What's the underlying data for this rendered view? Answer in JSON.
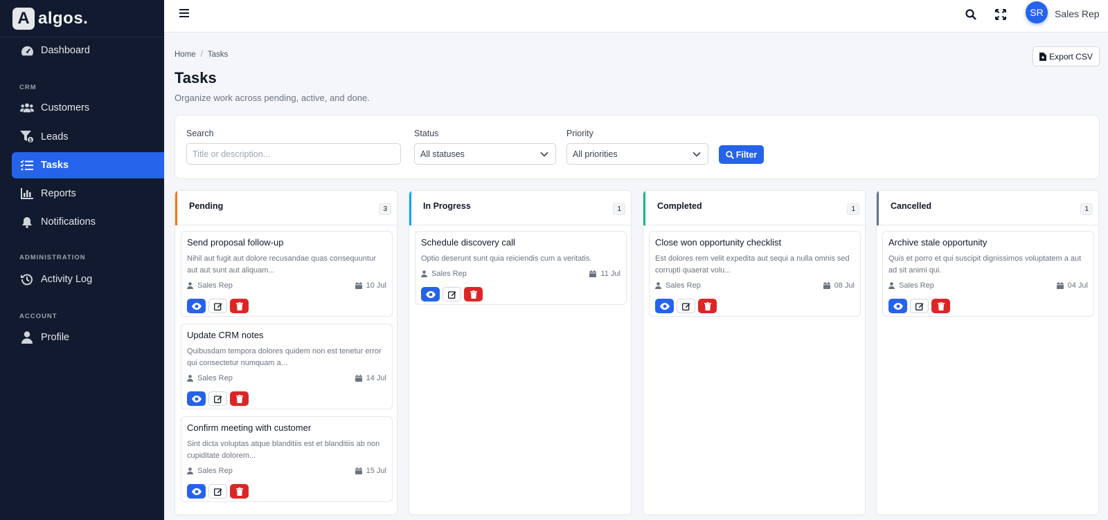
{
  "brand": {
    "mark": "A",
    "name": "algos."
  },
  "nav": {
    "dashboard": "Dashboard",
    "crm_section": "CRM",
    "customers": "Customers",
    "leads": "Leads",
    "tasks": "Tasks",
    "reports": "Reports",
    "notifications": "Notifications",
    "admin_section": "ADMINISTRATION",
    "activity_log": "Activity Log",
    "account_section": "ACCOUNT",
    "profile": "Profile"
  },
  "topbar": {
    "avatar_initials": "SR",
    "user_name": "Sales Rep"
  },
  "breadcrumb": {
    "home": "Home",
    "sep": "/",
    "current": "Tasks"
  },
  "page": {
    "title": "Tasks",
    "subtitle": "Organize work across pending, active, and done.",
    "export_label": "Export CSV"
  },
  "filters": {
    "search_label": "Search",
    "search_placeholder": "Title or description...",
    "status_label": "Status",
    "status_value": "All statuses",
    "priority_label": "Priority",
    "priority_value": "All priorities",
    "filter_button": "Filter"
  },
  "columns": [
    {
      "title": "Pending",
      "count": "3",
      "accent": "#f97316",
      "tasks": [
        {
          "title": "Send proposal follow-up",
          "desc": "Nihil aut fugit aut dolore recusandae quas consequuntur aut aut sunt aut aliquam...",
          "owner": "Sales Rep",
          "date": "10 Jul"
        },
        {
          "title": "Update CRM notes",
          "desc": "Quibusdam tempora dolores quidem non est tenetur error qui consectetur numquam a...",
          "owner": "Sales Rep",
          "date": "14 Jul"
        },
        {
          "title": "Confirm meeting with customer",
          "desc": "Sint dicta voluptas atque blanditiis est et blanditiis ab non cupiditate dolorem...",
          "owner": "Sales Rep",
          "date": "15 Jul"
        }
      ]
    },
    {
      "title": "In Progress",
      "count": "1",
      "accent": "#0ea5e9",
      "tasks": [
        {
          "title": "Schedule discovery call",
          "desc": "Optio deserunt sunt quia reiciendis cum a veritatis.",
          "owner": "Sales Rep",
          "date": "11 Jul"
        }
      ]
    },
    {
      "title": "Completed",
      "count": "1",
      "accent": "#10b981",
      "tasks": [
        {
          "title": "Close won opportunity checklist",
          "desc": "Est dolores rem velit expedita aut sequi a nulla omnis sed corrupti quaerat volu...",
          "owner": "Sales Rep",
          "date": "08 Jul"
        }
      ]
    },
    {
      "title": "Cancelled",
      "count": "1",
      "accent": "#64748b",
      "tasks": [
        {
          "title": "Archive stale opportunity",
          "desc": "Quis et porro et qui suscipit dignissimos voluptatem a aut ad sit animi qui.",
          "owner": "Sales Rep",
          "date": "04 Jul"
        }
      ]
    }
  ],
  "colors": {
    "primary": "#2563eb",
    "danger": "#dc2626",
    "sidebar": "#111a2e"
  }
}
